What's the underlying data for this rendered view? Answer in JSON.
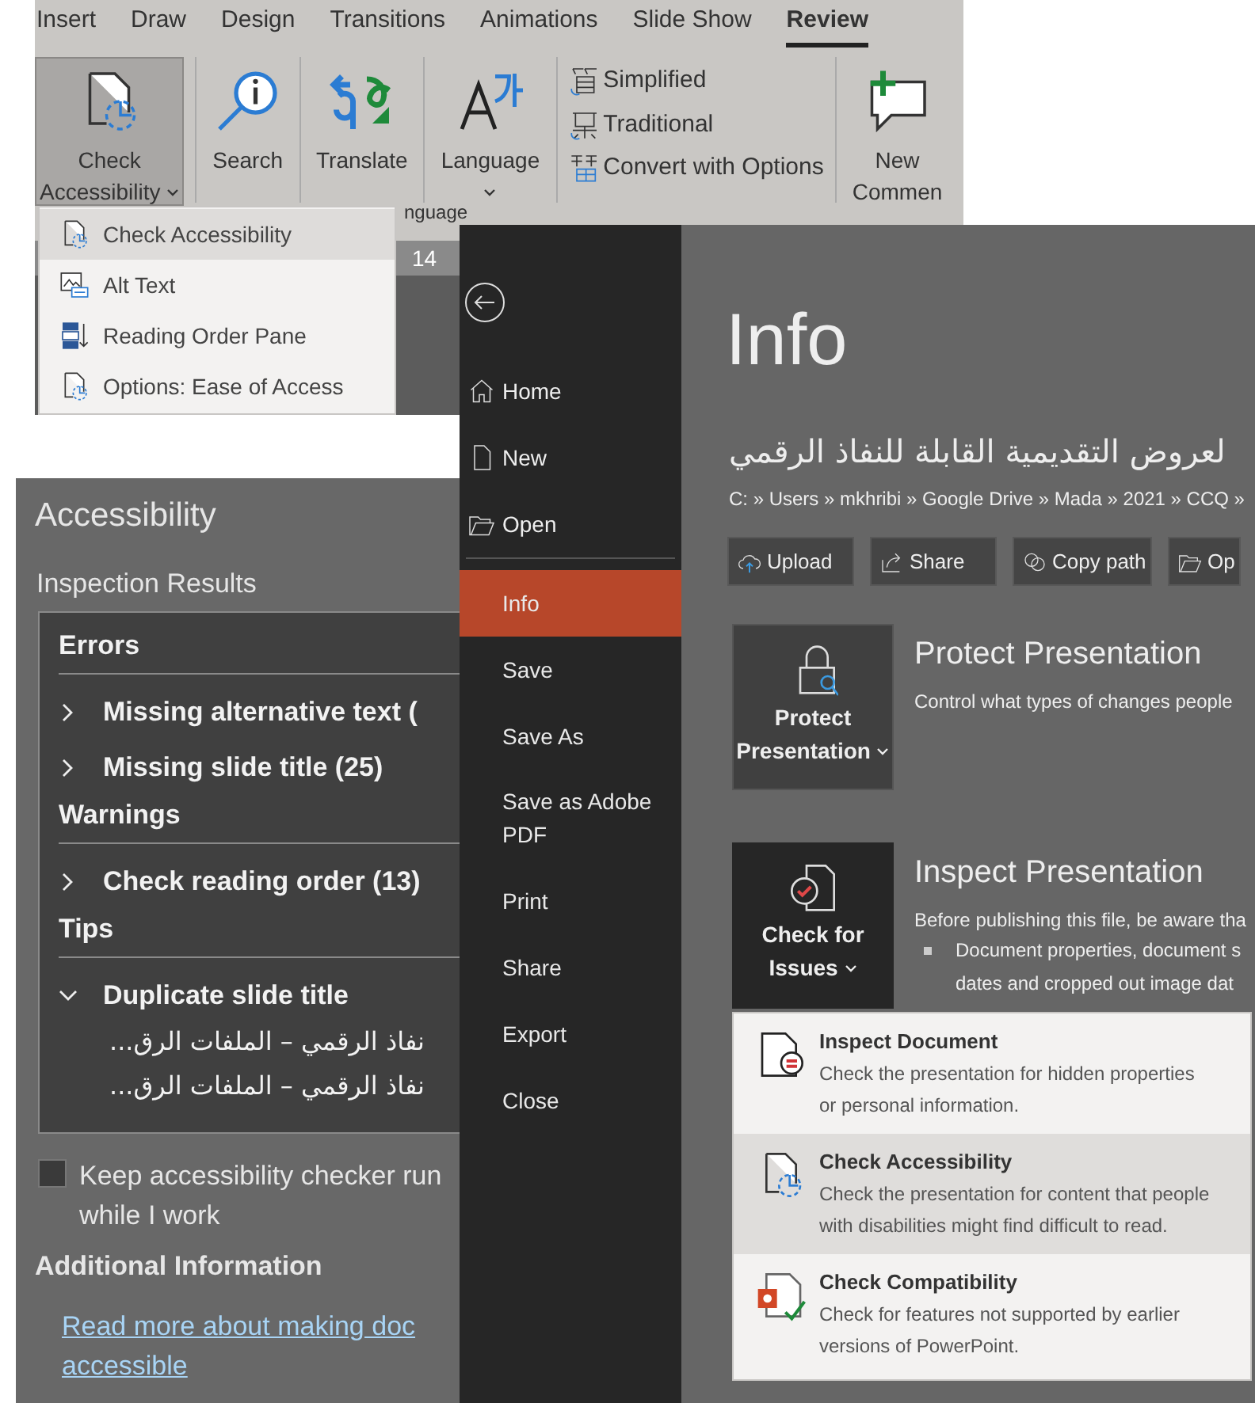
{
  "ribbon_window": {
    "tabs": [
      {
        "label": "Insert",
        "selected": false
      },
      {
        "label": "Draw",
        "selected": false
      },
      {
        "label": "Design",
        "selected": false
      },
      {
        "label": "Transitions",
        "selected": false
      },
      {
        "label": "Animations",
        "selected": false
      },
      {
        "label": "Slide Show",
        "selected": false
      },
      {
        "label": "Review",
        "selected": true
      }
    ],
    "commands": [
      {
        "kind": "large",
        "lines": [
          "Check",
          "Accessibility"
        ],
        "dropdown": true,
        "pressed": true
      },
      {
        "kind": "large",
        "lines": [
          "Search"
        ],
        "dropdown": false,
        "pressed": false
      },
      {
        "kind": "large",
        "lines": [
          "Translate"
        ],
        "dropdown": false,
        "pressed": false
      },
      {
        "kind": "large",
        "lines": [
          "Language"
        ],
        "dropdown": true,
        "pressed": false
      },
      {
        "kind": "stack",
        "items": [
          "Simplified",
          "Traditional",
          "Convert with Options"
        ]
      },
      {
        "kind": "large",
        "lines": [
          "New",
          "Commen"
        ],
        "dropdown": false,
        "pressed": false
      }
    ],
    "group_label": "nguage",
    "ruler_label": "14",
    "menu": [
      {
        "label": "Check Accessibility",
        "selected": true
      },
      {
        "label": "Alt Text",
        "selected": false
      },
      {
        "label": "Reading Order Pane",
        "selected": false
      },
      {
        "label": "Options: Ease of Access",
        "selected": false
      }
    ]
  },
  "accessibility_pane": {
    "title": "Accessibility",
    "subtitle": "Inspection Results",
    "groups": [
      {
        "heading": "Errors",
        "items": [
          {
            "label": "Missing alternative text (",
            "expanded": false
          },
          {
            "label": "Missing slide title (25)",
            "expanded": false
          }
        ]
      },
      {
        "heading": "Warnings",
        "items": [
          {
            "label": "Check reading order (13)",
            "expanded": false
          }
        ]
      },
      {
        "heading": "Tips",
        "items": [
          {
            "label": "Duplicate slide title",
            "expanded": true,
            "children": [
              "نفاذ الرقمي – الملفات الرق...",
              "نفاذ الرقمي – الملفات الرق..."
            ]
          }
        ]
      }
    ],
    "keep_running": {
      "checked": false,
      "lines": [
        "Keep accessibility checker run",
        "while I work"
      ]
    },
    "additional_heading": "Additional Information",
    "link_lines": [
      "Read more about making doc",
      "accessible"
    ]
  },
  "backstage": {
    "nav": [
      {
        "label": "Home",
        "selected": false
      },
      {
        "label": "New",
        "selected": false
      },
      {
        "label": "Open",
        "selected": false
      },
      {
        "label": "Info",
        "selected": true
      },
      {
        "label": "Save",
        "selected": false
      },
      {
        "label": "Save As",
        "selected": false
      },
      {
        "label": "Save as Adobe PDF",
        "selected": false
      },
      {
        "label": "Print",
        "selected": false
      },
      {
        "label": "Share",
        "selected": false
      },
      {
        "label": "Export",
        "selected": false
      },
      {
        "label": "Close",
        "selected": false
      }
    ],
    "title": "Info",
    "file_name": "لعروض التقديمية القابلة للنفاذ الرقمي",
    "path": "C: » Users » mkhribi » Google Drive » Mada » 2021 » CCQ »",
    "actions": [
      "Upload",
      "Share",
      "Copy path",
      "Op"
    ],
    "sections": [
      {
        "kind": "protect",
        "open": false,
        "tile_lines": [
          "Protect",
          "Presentation"
        ],
        "heading": "Protect Presentation",
        "description": "Control what types of changes people"
      },
      {
        "kind": "inspect",
        "open": true,
        "tile_lines": [
          "Check for",
          "Issues"
        ],
        "heading": "Inspect Presentation",
        "description": "Before publishing this file, be aware tha",
        "bullet_lines": [
          "Document properties, document s",
          "dates and cropped out image dat"
        ]
      }
    ],
    "issues_menu": [
      {
        "title": "Inspect Document",
        "description": "Check the presentation for hidden properties or personal information.",
        "selected": false
      },
      {
        "title": "Check Accessibility",
        "description": "Check the presentation for content that people with disabilities might find difficult to read.",
        "selected": true
      },
      {
        "title": "Check Compatibility",
        "description": "Check for features not supported by earlier versions of PowerPoint.",
        "selected": false
      }
    ]
  }
}
